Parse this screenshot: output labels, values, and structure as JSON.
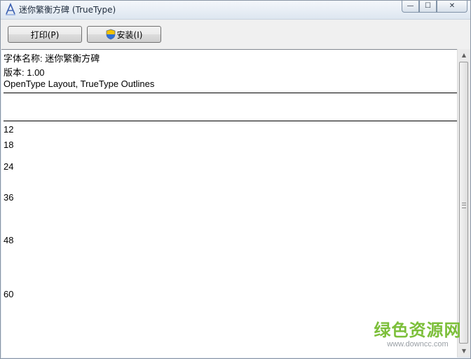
{
  "window": {
    "title": "迷你繁衡方碑 (TrueType)",
    "controls": {
      "minimize": "—",
      "maximize": "☐",
      "close": "✕"
    }
  },
  "toolbar": {
    "print_label": "打印(P)",
    "install_label": "安装(I)"
  },
  "font_info": {
    "name_line": "字体名称: 迷你繁衡方碑",
    "version_line": "版本: 1.00",
    "format_line": "OpenType Layout, TrueType Outlines"
  },
  "sample_sizes": [
    "12",
    "18",
    "24",
    "36",
    "48",
    "60"
  ],
  "watermark": {
    "main": "绿色资源网",
    "sub": "www.downcc.com"
  },
  "colors": {
    "watermark_green": "#7cbf3a",
    "titlebar": "#dde6f0"
  },
  "icons": {
    "title": "font-viewer-icon",
    "install": "uac-shield-icon",
    "scroll_up": "chevron-up-icon",
    "scroll_down": "chevron-down-icon"
  }
}
